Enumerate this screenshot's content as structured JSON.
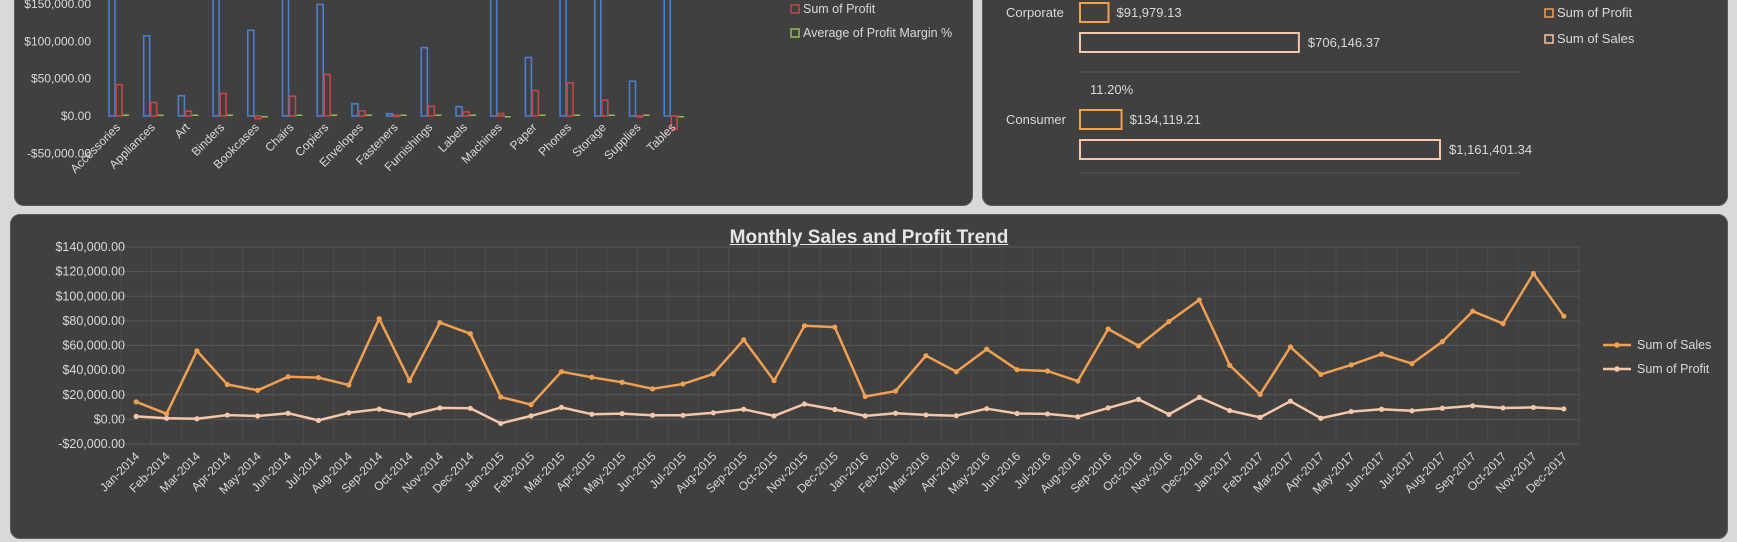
{
  "colors": {
    "panel_bg": "#404040",
    "sales_blue": "#4a7fd1",
    "profit_red": "#c9434a",
    "margin_green": "#8fc04a",
    "sales_orange": "#f0a050",
    "profit_peach": "#f6c6a8",
    "text": "#d9d9d9"
  },
  "chart_data": [
    {
      "type": "bar",
      "categories": [
        "Accessories",
        "Appliances",
        "Art",
        "Binders",
        "Bookcases",
        "Chairs",
        "Copiers",
        "Envelopes",
        "Fasteners",
        "Furnishings",
        "Labels",
        "Machines",
        "Paper",
        "Phones",
        "Storage",
        "Supplies",
        "Tables"
      ],
      "series": [
        {
          "name": "",
          "values": [
            167380,
            107532,
            27119,
            203413,
            114880,
            328449,
            149528,
            16476,
            3024,
            91705,
            12486,
            189239,
            78479,
            330007,
            223844,
            46674,
            206966
          ]
        },
        {
          "name": "Sum of Profit",
          "values": [
            41937,
            18138,
            6528,
            30222,
            -3473,
            26590,
            55618,
            6964,
            950,
            13059,
            5546,
            3385,
            34054,
            44516,
            21279,
            -1189,
            -17725
          ]
        },
        {
          "name": "Average of Profit Margin %",
          "values": [
            0.25,
            0.14,
            0.31,
            0.16,
            -0.05,
            0.06,
            0.32,
            0.42,
            0.3,
            0.14,
            0.43,
            -0.04,
            0.43,
            0.12,
            0.09,
            0.08,
            -0.16
          ]
        }
      ],
      "y_tick_labels": [
        "-$50,000.00",
        "$0.00",
        "$50,000.00",
        "$100,000.00",
        "$150,000.00"
      ],
      "ylim": [
        -50000,
        150000
      ],
      "legend": [
        "Sum of Profit",
        "Average of Profit Margin %"
      ],
      "legend_placement": "right"
    },
    {
      "type": "bar",
      "orientation": "horizontal",
      "categories": [
        "Corporate",
        "Consumer"
      ],
      "series": [
        {
          "name": "Sum of Profit",
          "values": [
            91979.13,
            134119.21
          ],
          "labels": [
            "$91,979.13",
            "$134,119.21"
          ]
        },
        {
          "name": "Sum of Sales",
          "values": [
            706146.37,
            1161401.34
          ],
          "labels": [
            "$706,146.37",
            "$1,161,401.34"
          ]
        }
      ],
      "annotations": [
        "11.20%"
      ],
      "legend": [
        "Sum of Profit",
        "Sum of Sales"
      ],
      "legend_placement": "top-right"
    },
    {
      "type": "line",
      "title": "Monthly Sales and Profit Trend",
      "x": [
        "Jan-2014",
        "Feb-2014",
        "Mar-2014",
        "Apr-2014",
        "May-2014",
        "Jun-2014",
        "Jul-2014",
        "Aug-2014",
        "Sep-2014",
        "Oct-2014",
        "Nov-2014",
        "Dec-2014",
        "Jan-2015",
        "Feb-2015",
        "Mar-2015",
        "Apr-2015",
        "May-2015",
        "Jun-2015",
        "Jul-2015",
        "Aug-2015",
        "Sep-2015",
        "Oct-2015",
        "Nov-2015",
        "Dec-2015",
        "Jan-2016",
        "Feb-2016",
        "Mar-2016",
        "Apr-2016",
        "May-2016",
        "Jun-2016",
        "Jul-2016",
        "Aug-2016",
        "Sep-2016",
        "Oct-2016",
        "Nov-2016",
        "Dec-2016",
        "Jan-2017",
        "Feb-2017",
        "Mar-2017",
        "Apr-2017",
        "May-2017",
        "Jun-2017",
        "Jul-2017",
        "Aug-2017",
        "Sep-2017",
        "Oct-2017",
        "Nov-2017",
        "Dec-2017"
      ],
      "series": [
        {
          "name": "Sum of Sales",
          "values": [
            14237,
            4520,
            55691,
            28295,
            23648,
            34595,
            33946,
            27909,
            81777,
            31453,
            78629,
            69546,
            18174,
            11951,
            38726,
            34195,
            30132,
            24797,
            28765,
            36898,
            64596,
            31405,
            75973,
            74920,
            18543,
            22979,
            51716,
            38750,
            56988,
            40345,
            39262,
            31115,
            73410,
            59688,
            79412,
            96999,
            43971,
            20301,
            58872,
            36522,
            44261,
            52982,
            45264,
            63121,
            87867,
            77777,
            118448,
            83829
          ]
        },
        {
          "name": "Sum of Profit",
          "values": [
            2450,
            862,
            498,
            3489,
            2739,
            4977,
            -841,
            5319,
            8329,
            3449,
            9292,
            8983,
            -3281,
            2814,
            9732,
            4187,
            4668,
            3335,
            3288,
            5355,
            8209,
            2817,
            12474,
            8016,
            2824,
            5004,
            3611,
            2978,
            8662,
            4750,
            4432,
            2062,
            9328,
            16243,
            4011,
            17885,
            7140,
            1613,
            14752,
            933,
            6343,
            8223,
            6953,
            9041,
            10991,
            9275,
            9690,
            8483
          ]
        }
      ],
      "y_tick_labels": [
        "-$20,000.00",
        "$0.00",
        "$20,000.00",
        "$40,000.00",
        "$60,000.00",
        "$80,000.00",
        "$100,000.00",
        "$120,000.00",
        "$140,000.00"
      ],
      "ylim": [
        -20000,
        140000
      ],
      "legend": [
        "Sum of Sales",
        "Sum of Profit"
      ],
      "legend_placement": "right",
      "grid": true
    }
  ]
}
